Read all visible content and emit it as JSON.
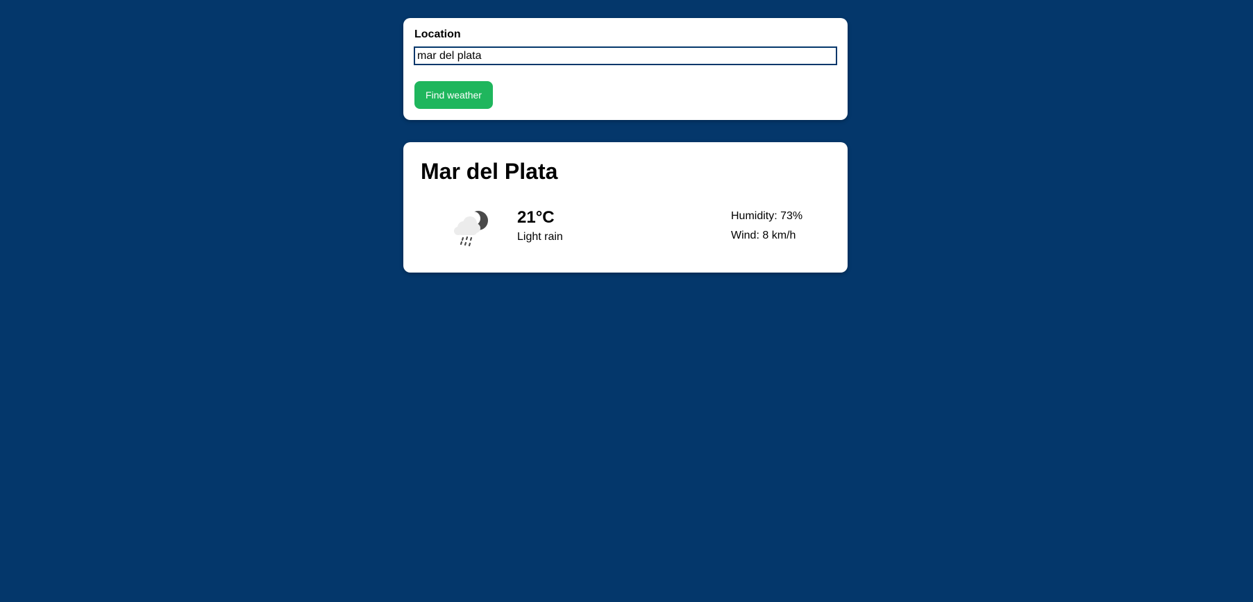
{
  "colors": {
    "page_background": "#04376b",
    "card_background": "#ffffff",
    "button_background": "#1fb65d",
    "button_text": "#ffffff"
  },
  "search": {
    "label": "Location",
    "input_value": "mar del plata",
    "button_label": "Find weather"
  },
  "weather": {
    "city": "Mar del Plata",
    "icon": "cloud-moon-rain-icon",
    "temperature": "21°C",
    "condition": "Light rain",
    "humidity": "Humidity: 73%",
    "wind": "Wind: 8 km/h"
  }
}
